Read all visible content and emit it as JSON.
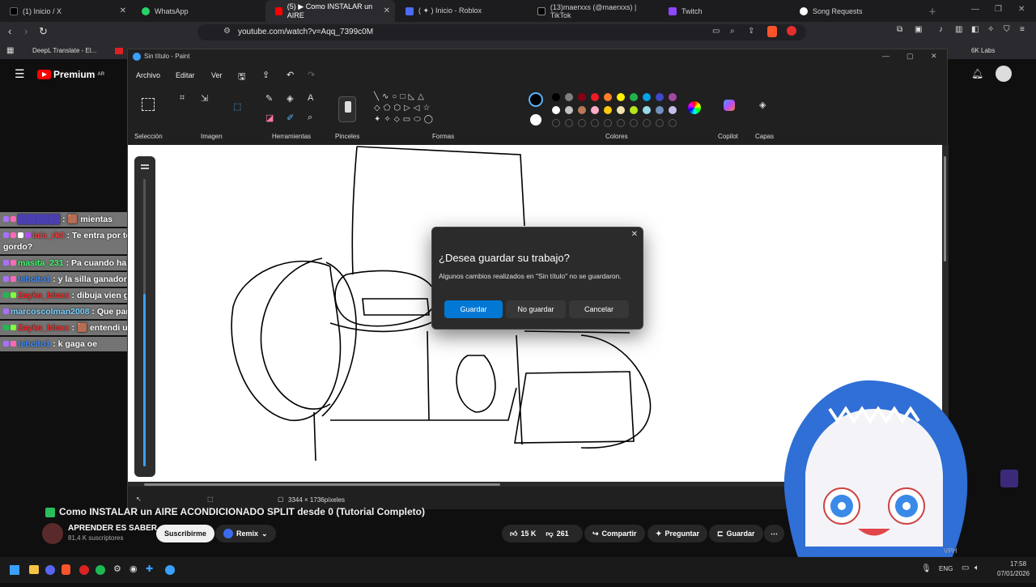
{
  "browser": {
    "tabs": [
      {
        "label": "(1) Inicio / X",
        "color": "#000000"
      },
      {
        "label": "WhatsApp",
        "color": "#25D366"
      },
      {
        "label": "(5) ▶ Como INSTALAR un AIRE",
        "color": "#ff0000"
      },
      {
        "label": "( ✦ ) Inicio - Roblox",
        "color": "#4a6cf7"
      },
      {
        "label": "(13)maerxxs (@maerxxs) | TikTok",
        "color": "#000000"
      },
      {
        "label": "Twitch",
        "color": "#9146ff"
      },
      {
        "label": "Song Requests",
        "color": "#ffffff"
      }
    ],
    "url": "youtube.com/watch?v=Aqq_7399c0M",
    "bookmarks": [
      "DeepL Translate - El...",
      "6K Labs"
    ]
  },
  "youtube": {
    "logo": "Premium",
    "logo_sup": "AR",
    "video_title": "Como INSTALAR un AIRE ACONDICIONADO SPLIT desde 0 (Tutorial Completo)",
    "channel": "APRENDER ES SABER",
    "subscribers": "81,4 K suscriptores",
    "subscribe": "Suscribirme",
    "remix": "Remix",
    "likes": "15 K",
    "dislikes": "261",
    "share": "Compartir",
    "ask": "Preguntar",
    "save": "Guardar",
    "watermark": "VPH"
  },
  "paint": {
    "title": "Sin título - Paint",
    "menu": [
      "Archivo",
      "Editar",
      "Ver"
    ],
    "groups": [
      "Selección",
      "Imagen",
      "Herramientas",
      "Pinceles",
      "Formas",
      "Colores",
      "Copilot",
      "Capas"
    ],
    "status_size": "3344 × 1736píxeles",
    "palette": [
      "#000000",
      "#7f7f7f",
      "#880015",
      "#ed1c24",
      "#ff7f27",
      "#fff200",
      "#22b14c",
      "#00a2e8",
      "#3f48cc",
      "#a349a4",
      "#ffffff",
      "#c3c3c3",
      "#b97a57",
      "#ffaec9",
      "#ffc90e",
      "#efe4b0",
      "#b5e61d",
      "#99d9ea",
      "#7092be",
      "#c8bfe7"
    ]
  },
  "dialog": {
    "title": "¿Desea guardar su trabajo?",
    "message": "Algunos cambios realizados en \"Sin título\" no se guardaron.",
    "save": "Guardar",
    "dont_save": "No guardar",
    "cancel": "Cancelar",
    "accent": "#0078d4"
  },
  "chat": [
    {
      "user": "",
      "text": ": 🟫 mientas",
      "color": "#4b3fb0"
    },
    {
      "user": "luis_rk3",
      "text": ": Te entra por todos lados gordo?",
      "color": "#ff3b3b"
    },
    {
      "user": "masita_231",
      "text": ": Pa cuando habitaciontour",
      "color": "#3bff6a"
    },
    {
      "user": "tebcito1",
      "text": ": y la silla ganadora de mil potos?",
      "color": "#3b8bff"
    },
    {
      "user": "Zayko_bloxx",
      "text": ": dibuja vien gordo",
      "color": "#ff2a2a"
    },
    {
      "user": "marcoscolman2008",
      "text": ": Que pared",
      "color": "#7ad0ff"
    },
    {
      "user": "Zayko_bloxx",
      "text": ": 🟫 entendi una verga",
      "color": "#ff2a2a"
    },
    {
      "user": "tebcito1",
      "text": ": k gaga oe",
      "color": "#3b8bff"
    }
  ],
  "taskbar": {
    "language": "ENG",
    "time": "17:58",
    "date": "07/01/2026"
  }
}
